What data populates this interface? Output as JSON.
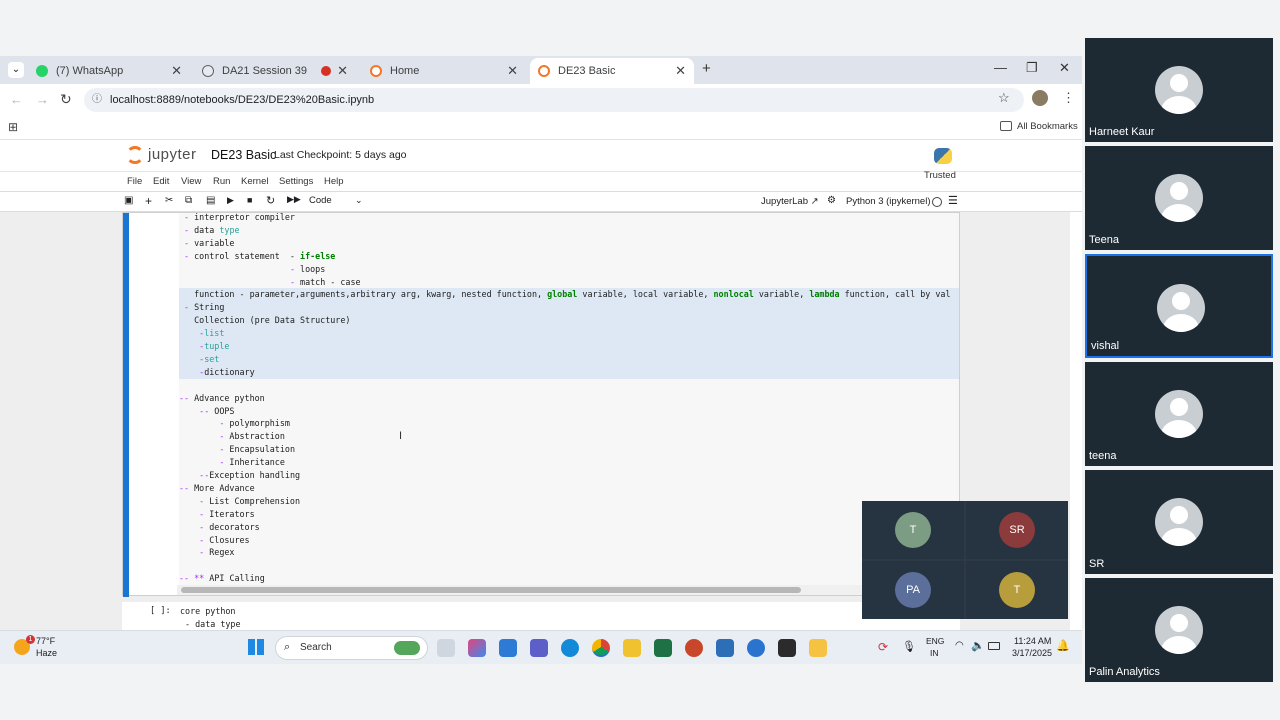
{
  "browser": {
    "tabs": [
      {
        "title": "(7) WhatsApp",
        "color": "#25d366"
      },
      {
        "title": "DA21 Session 39",
        "color": "#5f6368"
      },
      {
        "title": "Home",
        "color": "#f37726"
      },
      {
        "title": "DE23 Basic",
        "color": "#f37726"
      }
    ],
    "url": "localhost:8889/notebooks/DE23/DE23%20Basic.ipynb",
    "bookmarks_label": "All Bookmarks"
  },
  "jupyter": {
    "logo_text": "jupyter",
    "notebook_name": "DE23 Basic",
    "checkpoint": "Last Checkpoint: 5 days ago",
    "trusted": "Trusted",
    "menu": [
      "File",
      "Edit",
      "View",
      "Run",
      "Kernel",
      "Settings",
      "Help"
    ],
    "cell_type": "Code",
    "jupyterlab_link": "JupyterLab",
    "kernel": "Python 3 (ipykernel)",
    "cell2_prompt": "[ ]:",
    "cell2_lines": [
      "core python",
      " - data type"
    ]
  },
  "code_lines": [
    " - interpretor compiler",
    " - data type",
    " - variable",
    " - control statement  - if-else",
    "                      - loops",
    "                      - match - case",
    "   function - parameter,arguments,arbitrary arg, kwarg, nested function, global variable, local variable, nonlocal variable, lambda function, call by val",
    " - String",
    "   Collection (pre Data Structure)",
    "    -list",
    "    -tuple",
    "    -set",
    "    -dictionary",
    "",
    "-- Advance python",
    "    -- OOPS",
    "        - polymorphism",
    "        - Abstraction",
    "        - Encapsulation",
    "        - Inheritance",
    "    --Exception handling",
    "-- More Advance",
    "    - List Comprehension",
    "    - Iterators",
    "    - decorators",
    "    - Closures",
    "    - Regex",
    "",
    "-- ** API Calling"
  ],
  "call_overlay": [
    "T",
    "SR",
    "PA",
    "T"
  ],
  "call_colors": [
    "#7d9c84",
    "#8b3b3b",
    "#5b6f9a",
    "#b89d3c"
  ],
  "taskbar": {
    "temperature": "77°F",
    "weather": "Haze",
    "search": "Search",
    "lang1": "ENG",
    "lang2": "IN",
    "time": "11:24 AM",
    "date": "3/17/2025",
    "weather_badge": "1"
  },
  "participants": [
    "Harneet Kaur",
    "Teena",
    "vishal",
    "teena",
    "SR",
    "Palin Analytics"
  ]
}
